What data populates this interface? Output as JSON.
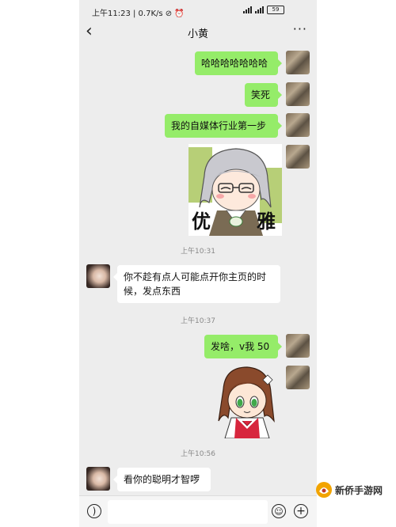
{
  "status_bar": {
    "left_text": "上午11:23 | 0.7K/s ⊘ ⏰",
    "battery": "59"
  },
  "nav": {
    "back_icon": "chevron-left-icon",
    "title": "小黄",
    "more_icon": "more-dots-icon"
  },
  "messages": [
    {
      "side": "me",
      "text": "哈哈哈哈哈哈哈"
    },
    {
      "side": "me",
      "text": "笑死"
    },
    {
      "side": "me",
      "text": "我的自媒体行业第一步"
    },
    {
      "side": "me",
      "type": "sticker",
      "caption_left": "优",
      "caption_right": "雅"
    },
    {
      "type": "timestamp",
      "text": "上午10:31"
    },
    {
      "side": "other",
      "text": "你不趁有点人可能点开你主页的时候，发点东西"
    },
    {
      "type": "timestamp",
      "text": "上午10:37"
    },
    {
      "side": "me",
      "text": "发啥，v我 50"
    },
    {
      "side": "me",
      "type": "sticker",
      "description": "anime girl"
    },
    {
      "type": "timestamp",
      "text": "上午10:56"
    },
    {
      "side": "other",
      "text": "看你的聪明才智啰"
    }
  ],
  "input_bar": {
    "voice_icon": "voice-icon",
    "emoji_icon": "emoji-icon",
    "plus_icon": "plus-icon"
  },
  "watermark": {
    "text": "新侨手游网"
  },
  "colors": {
    "my_bubble": "#95ec69",
    "their_bubble": "#ffffff",
    "chat_bg": "#ededed"
  }
}
